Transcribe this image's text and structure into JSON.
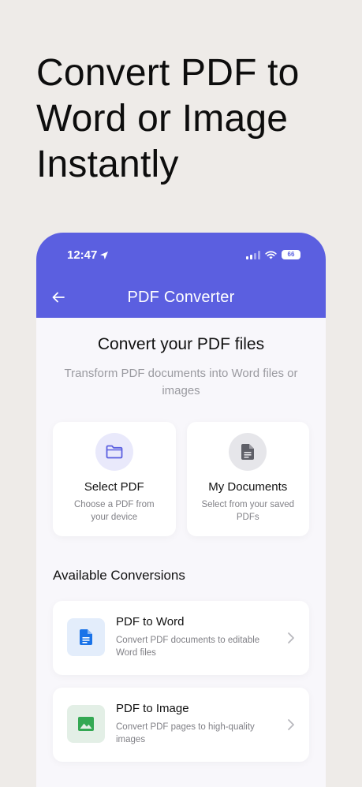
{
  "promo": {
    "headline": "Convert PDF to\nWord or Image\nInstantly"
  },
  "status_bar": {
    "time": "12:47",
    "battery": "66"
  },
  "header": {
    "title": "PDF Converter"
  },
  "main": {
    "title": "Convert your PDF files",
    "subtitle": "Transform PDF documents into Word files or images"
  },
  "cards": [
    {
      "title": "Select PDF",
      "desc": "Choose a PDF from your device",
      "icon": "folder-icon"
    },
    {
      "title": "My Documents",
      "desc": "Select from your saved PDFs",
      "icon": "document-icon"
    }
  ],
  "conversions": {
    "section_title": "Available Conversions",
    "items": [
      {
        "title": "PDF to Word",
        "desc": "Convert PDF documents to editable Word files",
        "icon": "word-doc-icon"
      },
      {
        "title": "PDF to Image",
        "desc": "Convert PDF pages to high-quality images",
        "icon": "image-icon"
      }
    ]
  },
  "colors": {
    "accent": "#5b5fe0",
    "background": "#eeebe8",
    "word_blue": "#1a73e8",
    "image_green": "#34a853"
  }
}
